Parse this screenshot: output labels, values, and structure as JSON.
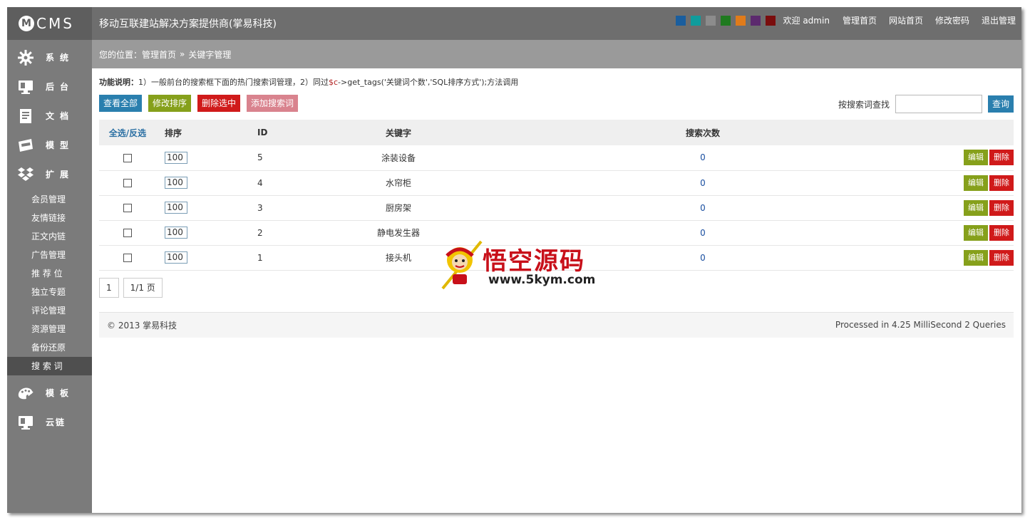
{
  "brand": {
    "logo_letter": "M",
    "logo_text": "CMS"
  },
  "sidebar": {
    "main_items": [
      {
        "label": "系统",
        "icon": "gear-icon"
      },
      {
        "label": "后台",
        "icon": "monitor-icon"
      },
      {
        "label": "文档",
        "icon": "document-icon"
      },
      {
        "label": "模型",
        "icon": "box-icon"
      },
      {
        "label": "扩展",
        "icon": "dropbox-icon"
      }
    ],
    "sub_items": [
      "会员管理",
      "友情链接",
      "正文内链",
      "广告管理",
      "推 荐 位",
      "独立专题",
      "评论管理",
      "资源管理",
      "备份还原",
      "搜 索 词"
    ],
    "bottom_items": [
      {
        "label": "模板",
        "icon": "palette-icon"
      },
      {
        "label": "云链",
        "icon": "monitor-icon"
      }
    ]
  },
  "header": {
    "title": "移动互联建站解决方案提供商(掌易科技)",
    "theme_colors": [
      "#1a5e9e",
      "#0f9c9c",
      "#8c8c8c",
      "#1f7a1f",
      "#e07b1a",
      "#5c2a6e",
      "#7a0d0d"
    ],
    "welcome": "欢迎 admin",
    "links": [
      "管理首页",
      "网站首页",
      "修改密码",
      "退出管理"
    ]
  },
  "breadcrumb": {
    "location": "您的位置：管理首页",
    "separator": "»",
    "current": "关键字管理"
  },
  "note": {
    "label": "功能说明：",
    "text_a": "1）一般前台的搜索框下面的热门搜索词管理，2）同过",
    "code_var": "$c",
    "text_b": "->get_tags('关键词个数','SQL排序方式');方法调用"
  },
  "toolbar": {
    "view_all": "查看全部",
    "edit_sort": "修改排序",
    "delete_selected": "删除选中",
    "add_keyword": "添加搜索词",
    "search_label": "按搜索词查找",
    "search_button": "查询"
  },
  "table": {
    "headers": {
      "select": "全选/反选",
      "sort": "排序",
      "id": "ID",
      "keyword": "关键字",
      "count": "搜索次数"
    },
    "rows": [
      {
        "sort": "100",
        "id": "5",
        "keyword": "涂装设备",
        "count": "0"
      },
      {
        "sort": "100",
        "id": "4",
        "keyword": "水帘柜",
        "count": "0"
      },
      {
        "sort": "100",
        "id": "3",
        "keyword": "厨房架",
        "count": "0"
      },
      {
        "sort": "100",
        "id": "2",
        "keyword": "静电发生器",
        "count": "0"
      },
      {
        "sort": "100",
        "id": "1",
        "keyword": "接头机",
        "count": "0"
      }
    ],
    "edit_label": "编辑",
    "delete_label": "删除"
  },
  "pager": {
    "current": "1",
    "total": "1/1 页"
  },
  "footer": {
    "copyright": "© 2013   掌易科技",
    "stats": "Processed in 4.25 MilliSecond 2 Queries"
  },
  "watermark": {
    "title": "悟空源码",
    "url": "www.5kym.com"
  }
}
